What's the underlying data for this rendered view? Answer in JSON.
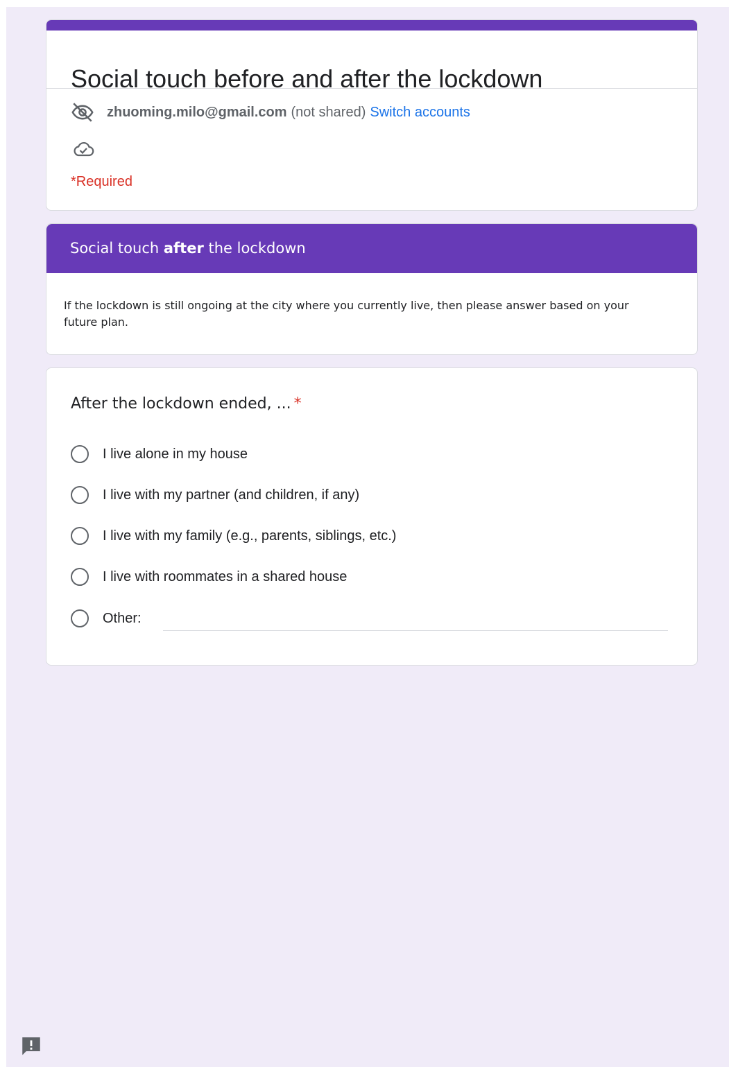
{
  "form": {
    "title": "Social touch before and after the lockdown",
    "account_email": "zhuoming.milo@gmail.com",
    "not_shared": "(not shared)",
    "switch_accounts": "Switch accounts",
    "required_note": "*Required"
  },
  "section": {
    "title_prefix": "Social touch ",
    "title_bold": "after",
    "title_suffix": " the lockdown",
    "description": "If the lockdown is still ongoing at the city where you currently live, then please answer based on your future plan."
  },
  "question": {
    "title": "After the lockdown ended, ...",
    "required_marker": "*",
    "options": [
      "I live alone in my house",
      "I live with my partner (and children, if any)",
      "I live with my family (e.g., parents, siblings, etc.)",
      "I live with roommates in a shared house",
      "Other:"
    ],
    "other_value": ""
  },
  "colors": {
    "accent": "#673ab7",
    "background": "#f0ebf8",
    "link": "#1a73e8",
    "required": "#d93025"
  },
  "icons": {
    "visibility": "eye-off-icon",
    "cloud": "cloud-check-icon",
    "feedback": "feedback-icon"
  }
}
